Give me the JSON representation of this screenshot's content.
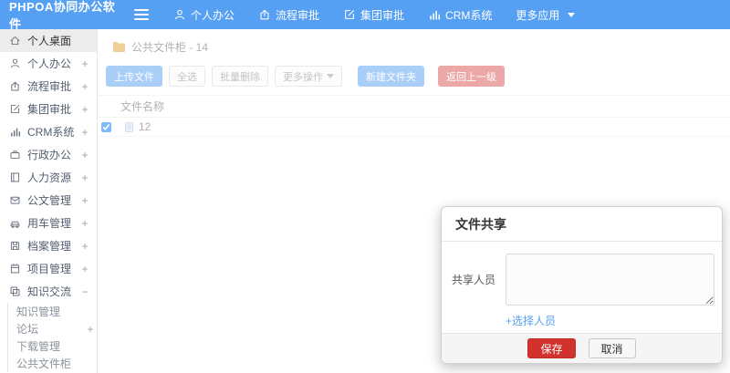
{
  "navbar": {
    "logo": "PHPOA协同办公软件",
    "items": [
      {
        "label": "个人办公"
      },
      {
        "label": "流程审批"
      },
      {
        "label": "集团审批"
      },
      {
        "label": "CRM系统"
      },
      {
        "label": "更多应用"
      }
    ]
  },
  "sidebar": {
    "items": [
      {
        "label": "个人桌面",
        "expand": ""
      },
      {
        "label": "个人办公",
        "expand": "+"
      },
      {
        "label": "流程审批",
        "expand": "+"
      },
      {
        "label": "集团审批",
        "expand": "+"
      },
      {
        "label": "CRM系统",
        "expand": "+"
      },
      {
        "label": "行政办公",
        "expand": "+"
      },
      {
        "label": "人力资源",
        "expand": "+"
      },
      {
        "label": "公文管理",
        "expand": "+"
      },
      {
        "label": "用车管理",
        "expand": "+"
      },
      {
        "label": "档案管理",
        "expand": "+"
      },
      {
        "label": "项目管理",
        "expand": "+"
      },
      {
        "label": "知识交流",
        "expand": "−"
      }
    ],
    "subitems": [
      {
        "label": "知识管理",
        "expand": ""
      },
      {
        "label": "论坛",
        "expand": "+"
      },
      {
        "label": "下载管理",
        "expand": ""
      },
      {
        "label": "公共文件柜",
        "expand": ""
      }
    ]
  },
  "content": {
    "breadcrumb": "公共文件柜 - 14",
    "toolbar": [
      {
        "label": "上传文件"
      },
      {
        "label": "全选"
      },
      {
        "label": "批量删除"
      },
      {
        "label": "更多操作"
      },
      {
        "label": "新建文件夹"
      },
      {
        "label": "返回上一级"
      }
    ],
    "table": {
      "header": "文件名称",
      "rows": [
        {
          "name": "12",
          "checked": true
        }
      ]
    }
  },
  "modal": {
    "title": "文件共享",
    "field_label": "共享人员",
    "textarea_value": "",
    "select_link": "+选择人员",
    "save_label": "保存",
    "cancel_label": "取消"
  },
  "colors": {
    "navbar": "#56a0f4",
    "primary": "#56a0f4",
    "danger": "#d9534f",
    "save_button": "#d2322d",
    "folder": "#e0a136"
  }
}
